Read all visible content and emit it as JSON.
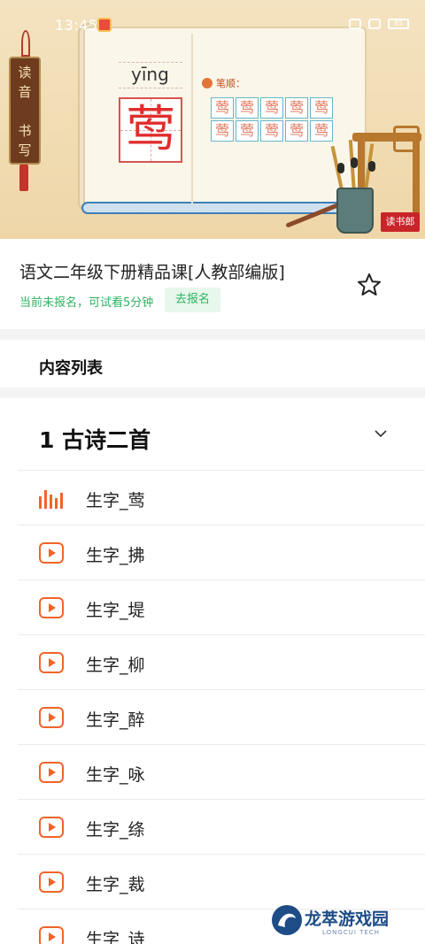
{
  "status_bar": {
    "time": "13:45",
    "battery": "85"
  },
  "hero": {
    "sign_chars": [
      "读",
      "音",
      "书",
      "写"
    ],
    "pinyin": "yīng",
    "character": "莺",
    "stroke_label": "笔顺：",
    "stroke_cells": [
      "莺",
      "莺",
      "莺",
      "莺",
      "莺",
      "莺",
      "莺",
      "莺",
      "莺",
      "莺"
    ],
    "badge": "读书郎"
  },
  "course": {
    "title": "语文二年级下册精品课[人教部编版]",
    "trial_status": "当前未报名，可试看5分钟",
    "enroll_label": "去报名"
  },
  "content": {
    "header": "内容列表",
    "chapter_title": "1 古诗二首",
    "lessons": [
      {
        "label": "生字_莺",
        "icon": "playing-equalizer-icon"
      },
      {
        "label": "生字_拂",
        "icon": "play-icon"
      },
      {
        "label": "生字_堤",
        "icon": "play-icon"
      },
      {
        "label": "生字_柳",
        "icon": "play-icon"
      },
      {
        "label": "生字_醉",
        "icon": "play-icon"
      },
      {
        "label": "生字_咏",
        "icon": "play-icon"
      },
      {
        "label": "生字_绦",
        "icon": "play-icon"
      },
      {
        "label": "生字_裁",
        "icon": "play-icon"
      },
      {
        "label": "生字_诗",
        "icon": "play-icon"
      }
    ]
  },
  "watermark": {
    "title": "龙萃游戏园",
    "subtitle": "LONGCUI TECH"
  },
  "colors": {
    "accent_orange": "#f0642a",
    "green": "#2fb362",
    "green_bg": "#e7f7ec"
  }
}
